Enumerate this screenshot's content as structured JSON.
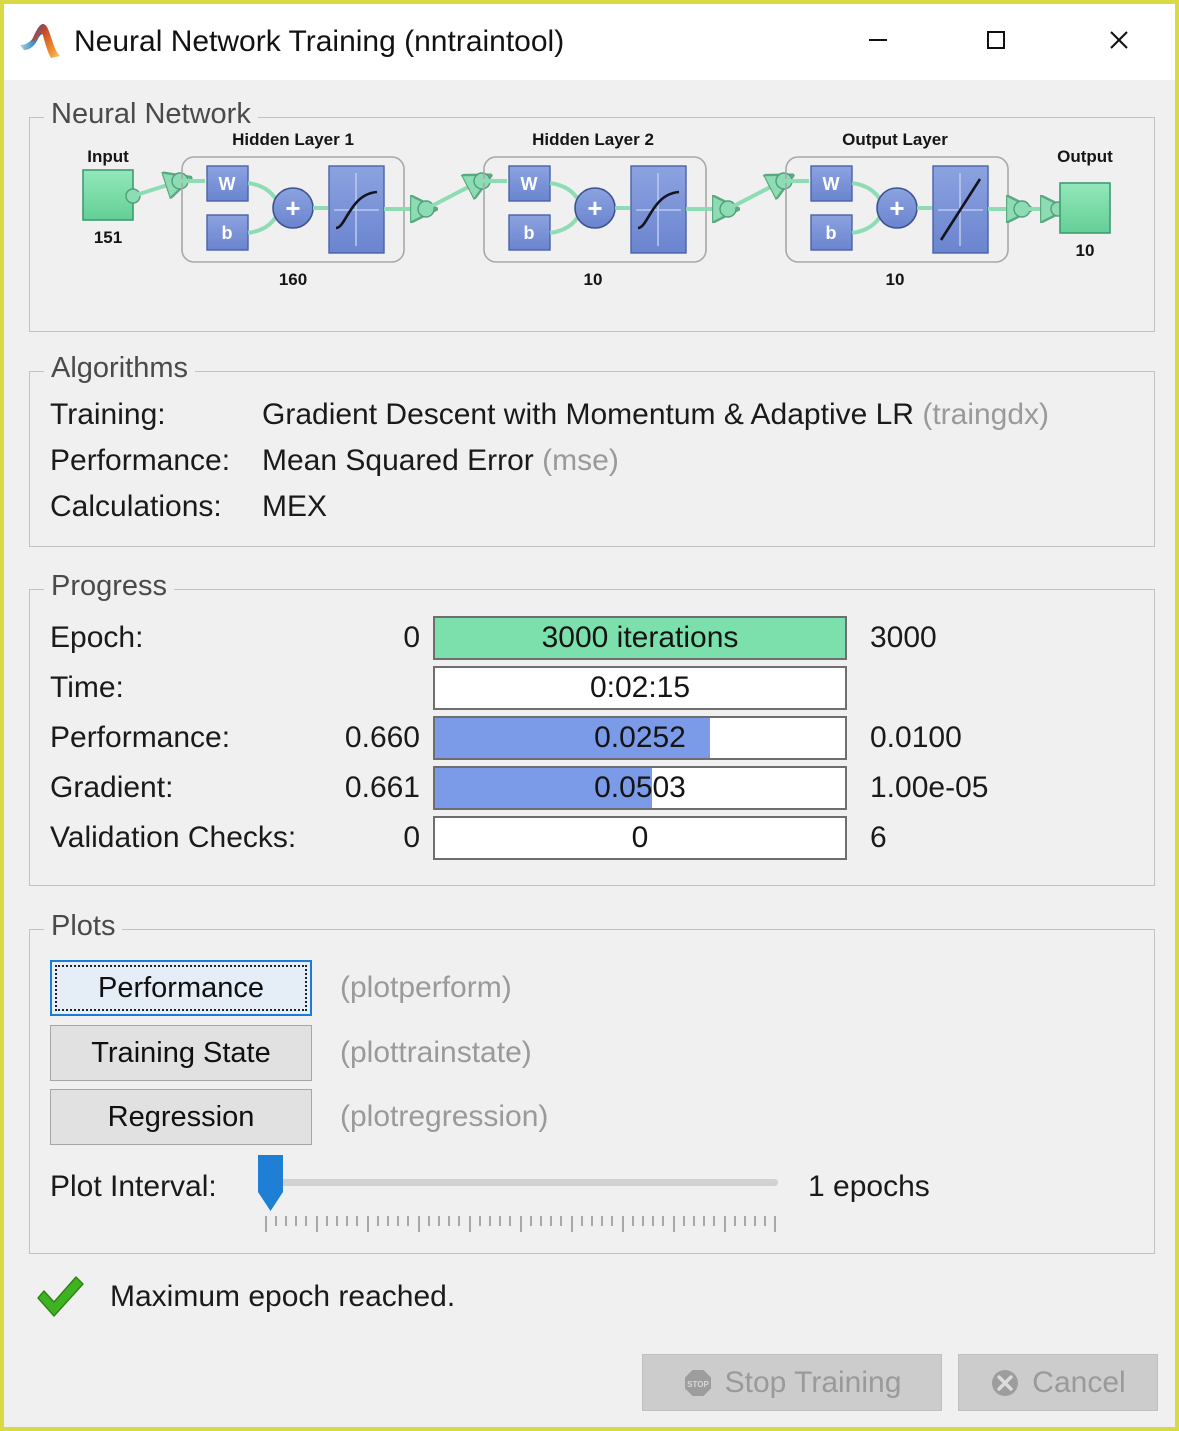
{
  "window": {
    "title": "Neural Network Training (nntraintool)",
    "app_icon": "matlab-membrane-icon",
    "controls": {
      "minimize": "minimize-icon",
      "maximize": "maximize-icon",
      "close": "close-icon"
    }
  },
  "neural_network": {
    "group_title": "Neural Network",
    "input": {
      "label": "Input",
      "size": "151"
    },
    "output": {
      "label": "Output",
      "size": "10"
    },
    "layers": [
      {
        "title": "Hidden Layer 1",
        "size": "160",
        "weight": "W",
        "bias": "b",
        "sum": "+",
        "activation": "sigmoid"
      },
      {
        "title": "Hidden Layer 2",
        "size": "10",
        "weight": "W",
        "bias": "b",
        "sum": "+",
        "activation": "sigmoid"
      },
      {
        "title": "Output Layer",
        "size": "10",
        "weight": "W",
        "bias": "b",
        "sum": "+",
        "activation": "linear"
      }
    ]
  },
  "algorithms": {
    "group_title": "Algorithms",
    "rows": [
      {
        "label": "Training:",
        "value": "Gradient Descent with Momentum & Adaptive LR",
        "paren": "(traingdx)"
      },
      {
        "label": "Performance:",
        "value": "Mean Squared Error",
        "paren": "(mse)"
      },
      {
        "label": "Calculations:",
        "value": "MEX",
        "paren": ""
      }
    ]
  },
  "progress": {
    "group_title": "Progress",
    "rows": [
      {
        "label": "Epoch:",
        "left": "0",
        "bar_text": "3000 iterations",
        "right": "3000",
        "fill_pct": 100,
        "fill_color": "#7ce0ac"
      },
      {
        "label": "Time:",
        "left": "",
        "bar_text": "0:02:15",
        "right": "",
        "fill_pct": 0,
        "fill_color": "#7b9be8"
      },
      {
        "label": "Performance:",
        "left": "0.660",
        "bar_text": "0.0252",
        "right": "0.0100",
        "fill_pct": 67,
        "fill_color": "#7b9be8"
      },
      {
        "label": "Gradient:",
        "left": "0.661",
        "bar_text": "0.0503",
        "right": "1.00e-05",
        "fill_pct": 53,
        "fill_color": "#7b9be8"
      },
      {
        "label": "Validation Checks:",
        "left": "0",
        "bar_text": "0",
        "right": "6",
        "fill_pct": 0,
        "fill_color": "#7b9be8"
      }
    ]
  },
  "plots": {
    "group_title": "Plots",
    "buttons": [
      {
        "label": "Performance",
        "paren": "(plotperform)",
        "focused": true
      },
      {
        "label": "Training State",
        "paren": "(plottrainstate)",
        "focused": false
      },
      {
        "label": "Regression",
        "paren": "(plotregression)",
        "focused": false
      }
    ],
    "slider": {
      "label": "Plot Interval:",
      "value_text": "1 epochs",
      "position_pct": 0,
      "thumb_color": "#1f7fd4"
    }
  },
  "status": {
    "icon": "green-check-icon",
    "text": "Maximum epoch reached."
  },
  "footer": {
    "stop_button": {
      "label": "Stop Training",
      "icon": "stop-sign-icon",
      "disabled": true
    },
    "cancel_button": {
      "label": "Cancel",
      "icon": "cancel-circle-icon",
      "disabled": true
    }
  }
}
